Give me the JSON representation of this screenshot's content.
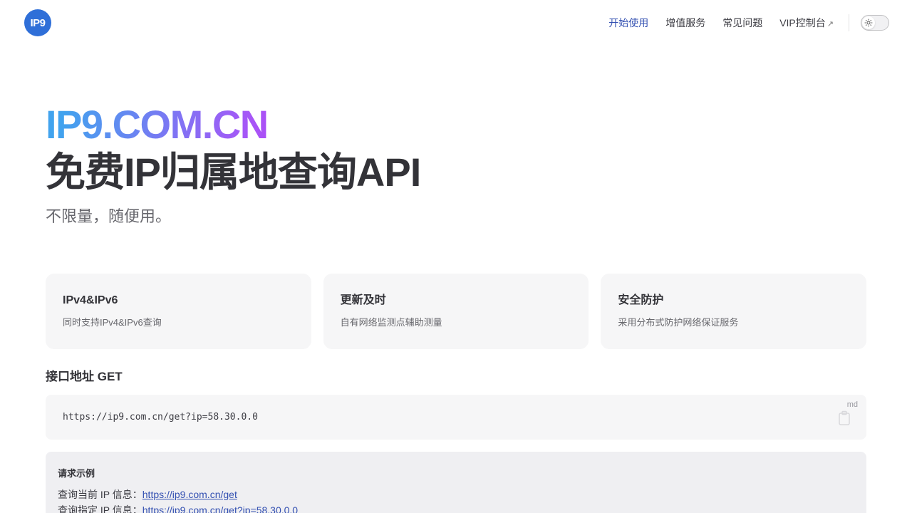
{
  "nav": {
    "logo_text": "IP9",
    "links": [
      {
        "label": "开始使用",
        "active": true
      },
      {
        "label": "增值服务"
      },
      {
        "label": "常见问题"
      },
      {
        "label": "VIP控制台",
        "external": true
      }
    ],
    "external_icon": "↗",
    "theme_icon": "sun-icon"
  },
  "hero": {
    "name": "IP9.COM.CN",
    "text": "免费IP归属地查询API",
    "tagline": "不限量，随便用。"
  },
  "features": [
    {
      "title": "IPv4&IPv6",
      "desc": "同时支持IPv4&IPv6查询"
    },
    {
      "title": "更新及时",
      "desc": "自有网络监测点辅助测量"
    },
    {
      "title": "安全防护",
      "desc": "采用分布式防护网络保证服务"
    }
  ],
  "api": {
    "heading": "接口地址 GET",
    "code": "https://ip9.com.cn/get?ip=58.30.0.0",
    "lang": "md",
    "copy_icon": "copy-icon"
  },
  "example": {
    "title": "请求示例",
    "rows": [
      {
        "label": "查询当前 IP 信息：",
        "link": "https://ip9.com.cn/get"
      },
      {
        "label": "查询指定 IP 信息：",
        "link": "https://ip9.com.cn/get?ip=58.30.0.0"
      }
    ]
  },
  "colors": {
    "brand": "#2f6fd8",
    "link": "#3451b2",
    "gradient_start": "#41a3ee",
    "gradient_end": "#c026f0"
  }
}
